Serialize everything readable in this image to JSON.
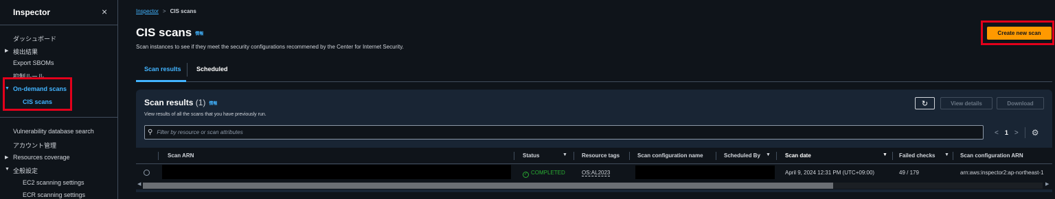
{
  "sidebar": {
    "title": "Inspector",
    "close_icon": "×",
    "items": [
      {
        "label": "ダッシュボード"
      },
      {
        "label": "検出結果"
      },
      {
        "label": "Export SBOMs"
      },
      {
        "label": "抑制ルール"
      },
      {
        "label": "On-demand scans"
      },
      {
        "label": "CIS scans"
      },
      {
        "label": "Vulnerability database search"
      },
      {
        "label": "アカウント管理"
      },
      {
        "label": "Resources coverage"
      },
      {
        "label": "全般設定"
      },
      {
        "label": "EC2 scanning settings"
      },
      {
        "label": "ECR scanning settings"
      }
    ]
  },
  "breadcrumb": {
    "root": "Inspector",
    "separator": ">",
    "current": "CIS scans"
  },
  "header": {
    "title": "CIS scans",
    "info": "情報",
    "description": "Scan instances to see if they meet the security configurations recommened by the Center for Internet Security.",
    "create_button": "Create new scan"
  },
  "tabs": [
    {
      "label": "Scan results",
      "active": true
    },
    {
      "label": "Scheduled",
      "active": false
    }
  ],
  "panel": {
    "title": "Scan results",
    "count": "(1)",
    "info": "情報",
    "description": "View results of all the scans that you have previously run.",
    "refresh_icon": "↻",
    "view_details": "View details",
    "download": "Download",
    "filter_placeholder": "Filter by resource or scan attributes",
    "search_icon": "⚲",
    "pager": {
      "prev": "<",
      "page": "1",
      "next": ">",
      "settings_icon": "⚙"
    }
  },
  "table": {
    "columns": [
      {
        "label": "Scan ARN"
      },
      {
        "label": "Status"
      },
      {
        "label": "Resource tags"
      },
      {
        "label": "Scan configuration name"
      },
      {
        "label": "Scheduled By"
      },
      {
        "label": "Scan date"
      },
      {
        "label": "Failed checks"
      },
      {
        "label": "Scan configuration ARN"
      }
    ],
    "sort_icon": "▼",
    "rows": [
      {
        "status": "COMPLETED",
        "status_icon": "✓",
        "resource_tags": "OS:AL2023",
        "scan_date": "April 9, 2024 12:31 PM (UTC+09:00)",
        "failed_checks": "49 / 179",
        "scan_configuration_arn": "arn:aws:inspector2:ap-northeast-1"
      }
    ]
  },
  "scrollbar": {
    "left_arrow": "◀",
    "right_arrow": "▶"
  },
  "colors": {
    "accent": "#42b4ff",
    "primary_button": "#ff9900",
    "success": "#29ad32",
    "highlight": "#e3001b"
  }
}
